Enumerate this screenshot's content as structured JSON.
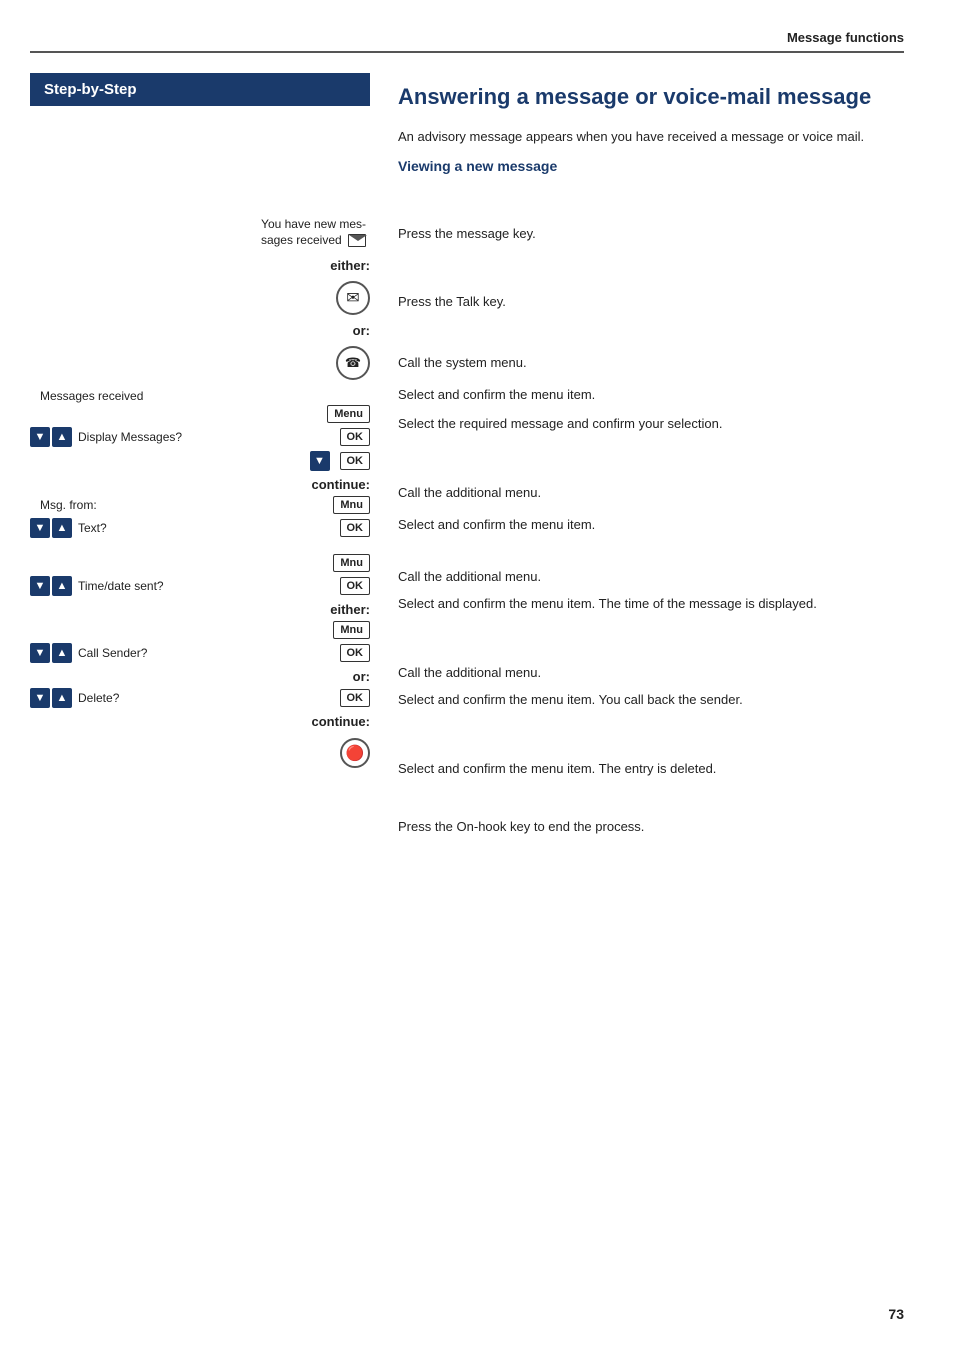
{
  "header": {
    "title": "Message functions"
  },
  "left_header": "Step-by-Step",
  "main_title": "Answering a message or voice-mail message",
  "description": "An advisory message appears when you have received a message or voice mail.",
  "section_viewing": "Viewing a new message",
  "rows": [
    {
      "id": "new-messages-display",
      "left_text": "You have new mes-sages received",
      "left_has_mail_icon": true,
      "right_text": ""
    },
    {
      "id": "either-label",
      "left_keyword": "either:",
      "right_text": ""
    },
    {
      "id": "message-key",
      "left_icon": "message",
      "right_text": "Press the message key."
    },
    {
      "id": "or-label",
      "left_keyword": "or:",
      "right_text": ""
    },
    {
      "id": "talk-key",
      "left_icon": "talk",
      "right_text": "Press the Talk key."
    },
    {
      "id": "messages-received",
      "left_text": "Messages received",
      "right_text": ""
    },
    {
      "id": "menu-btn",
      "left_button": "Menu",
      "right_text": "Call the system menu."
    },
    {
      "id": "display-messages",
      "left_arrows": true,
      "left_label": "Display Messages?",
      "left_button": "OK",
      "right_text": "Select and confirm the menu item."
    },
    {
      "id": "select-message",
      "left_arrows": true,
      "left_button": "OK",
      "right_text": "Select the required message and confirm your selection."
    },
    {
      "id": "continue-label",
      "left_keyword": "continue:",
      "right_text": ""
    },
    {
      "id": "msg-from-mnu",
      "left_label": "Msg. from:",
      "left_button": "Mnu",
      "right_text": "Call the additional menu."
    },
    {
      "id": "text-ok",
      "left_arrows": true,
      "left_label": "Text?",
      "left_button": "OK",
      "right_text": "Select and confirm the menu item."
    },
    {
      "id": "mnu-btn2",
      "left_button": "Mnu",
      "right_text": "Call the additional menu."
    },
    {
      "id": "time-date",
      "left_arrows": true,
      "left_label": "Time/date sent?",
      "left_button": "OK",
      "right_text": "Select and confirm the menu item. The time of the message is displayed."
    },
    {
      "id": "either-label2",
      "left_keyword": "either:",
      "right_text": ""
    },
    {
      "id": "mnu-btn3",
      "left_button": "Mnu",
      "right_text": "Call the additional menu."
    },
    {
      "id": "call-sender",
      "left_arrows": true,
      "left_label": "Call Sender?",
      "left_button": "OK",
      "right_text": "Select and confirm the menu item. You call back the sender."
    },
    {
      "id": "or-label2",
      "left_keyword": "or:",
      "right_text": ""
    },
    {
      "id": "delete",
      "left_arrows": true,
      "left_label": "Delete?",
      "left_button": "OK",
      "right_text": "Select and confirm the menu item. The entry is deleted."
    },
    {
      "id": "continue-label2",
      "left_keyword": "continue:",
      "right_text": ""
    },
    {
      "id": "onhook",
      "left_icon": "onhook",
      "right_text": "Press the On-hook key to end the process."
    }
  ],
  "page_number": "73"
}
